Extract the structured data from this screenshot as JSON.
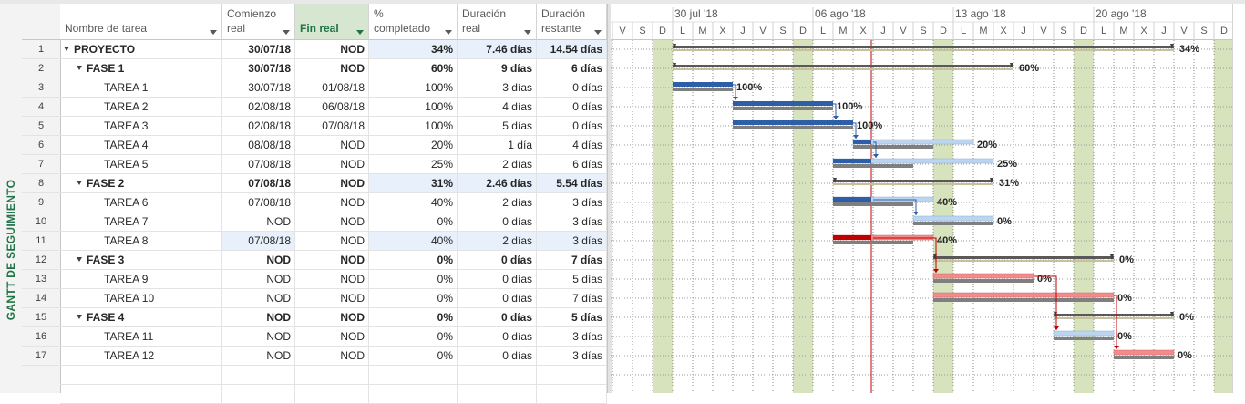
{
  "sidebar": {
    "view_label": "GANTT DE SEGUIMIENTO"
  },
  "columns": [
    {
      "key": "name",
      "line1": "",
      "line2": "Nombre de tarea"
    },
    {
      "key": "start",
      "line1": "Comienzo",
      "line2": "real"
    },
    {
      "key": "finish",
      "line1": "",
      "line2": "Fin real"
    },
    {
      "key": "pct",
      "line1": "%",
      "line2": "completado"
    },
    {
      "key": "dur",
      "line1": "Duración",
      "line2": "real"
    },
    {
      "key": "rem",
      "line1": "Duración",
      "line2": "restante"
    }
  ],
  "tasks": [
    {
      "id": "1",
      "name": "PROYECTO",
      "level": 0,
      "summary": true,
      "start": "30/07/18",
      "finish": "NOD",
      "pct": "34%",
      "dur": "7.46 días",
      "rem": "14.54 días"
    },
    {
      "id": "2",
      "name": "FASE 1",
      "level": 1,
      "summary": true,
      "start": "30/07/18",
      "finish": "NOD",
      "pct": "60%",
      "dur": "9 días",
      "rem": "6 días"
    },
    {
      "id": "3",
      "name": "TAREA 1",
      "level": 2,
      "summary": false,
      "start": "30/07/18",
      "finish": "01/08/18",
      "pct": "100%",
      "dur": "3 días",
      "rem": "0 días"
    },
    {
      "id": "4",
      "name": "TAREA 2",
      "level": 2,
      "summary": false,
      "start": "02/08/18",
      "finish": "06/08/18",
      "pct": "100%",
      "dur": "4 días",
      "rem": "0 días"
    },
    {
      "id": "5",
      "name": "TAREA 3",
      "level": 2,
      "summary": false,
      "start": "02/08/18",
      "finish": "07/08/18",
      "pct": "100%",
      "dur": "5 días",
      "rem": "0 días"
    },
    {
      "id": "6",
      "name": "TAREA 4",
      "level": 2,
      "summary": false,
      "start": "08/08/18",
      "finish": "NOD",
      "pct": "20%",
      "dur": "1 día",
      "rem": "4 días"
    },
    {
      "id": "7",
      "name": "TAREA 5",
      "level": 2,
      "summary": false,
      "start": "07/08/18",
      "finish": "NOD",
      "pct": "25%",
      "dur": "2 días",
      "rem": "6 días"
    },
    {
      "id": "8",
      "name": "FASE 2",
      "level": 1,
      "summary": true,
      "start": "07/08/18",
      "finish": "NOD",
      "pct": "31%",
      "dur": "2.46 días",
      "rem": "5.54 días"
    },
    {
      "id": "9",
      "name": "TAREA 6",
      "level": 2,
      "summary": false,
      "start": "07/08/18",
      "finish": "NOD",
      "pct": "40%",
      "dur": "2 días",
      "rem": "3 días"
    },
    {
      "id": "10",
      "name": "TAREA 7",
      "level": 2,
      "summary": false,
      "start": "NOD",
      "finish": "NOD",
      "pct": "0%",
      "dur": "0 días",
      "rem": "3 días"
    },
    {
      "id": "11",
      "name": "TAREA 8",
      "level": 2,
      "summary": false,
      "start": "07/08/18",
      "finish": "NOD",
      "pct": "40%",
      "dur": "2 días",
      "rem": "3 días"
    },
    {
      "id": "12",
      "name": "FASE 3",
      "level": 1,
      "summary": true,
      "start": "NOD",
      "finish": "NOD",
      "pct": "0%",
      "dur": "0 días",
      "rem": "7 días"
    },
    {
      "id": "13",
      "name": "TAREA 9",
      "level": 2,
      "summary": false,
      "start": "NOD",
      "finish": "NOD",
      "pct": "0%",
      "dur": "0 días",
      "rem": "5 días"
    },
    {
      "id": "14",
      "name": "TAREA 10",
      "level": 2,
      "summary": false,
      "start": "NOD",
      "finish": "NOD",
      "pct": "0%",
      "dur": "0 días",
      "rem": "7 días"
    },
    {
      "id": "15",
      "name": "FASE 4",
      "level": 1,
      "summary": true,
      "start": "NOD",
      "finish": "NOD",
      "pct": "0%",
      "dur": "0 días",
      "rem": "5 días"
    },
    {
      "id": "16",
      "name": "TAREA 11",
      "level": 2,
      "summary": false,
      "start": "NOD",
      "finish": "NOD",
      "pct": "0%",
      "dur": "0 días",
      "rem": "3 días"
    },
    {
      "id": "17",
      "name": "TAREA 12",
      "level": 2,
      "summary": false,
      "start": "NOD",
      "finish": "NOD",
      "pct": "0%",
      "dur": "0 días",
      "rem": "3 días"
    }
  ],
  "timescale": {
    "weeks": [
      "30 jul '18",
      "06 ago '18",
      "13 ago '18",
      "20 ago '18"
    ],
    "days": [
      "V",
      "S",
      "D",
      "L",
      "M",
      "X",
      "J",
      "V",
      "S",
      "D",
      "L",
      "M",
      "X",
      "J",
      "V",
      "S",
      "D",
      "L",
      "M",
      "X",
      "J",
      "V",
      "S",
      "D",
      "L",
      "M",
      "X",
      "J",
      "V",
      "S",
      "D"
    ]
  },
  "gantt": {
    "status_day": 13,
    "bars": [
      {
        "row": 1,
        "kind": "summary",
        "start": 3,
        "end": 28,
        "label": "34%"
      },
      {
        "row": 2,
        "kind": "summary",
        "start": 3,
        "end": 20,
        "label": "60%"
      },
      {
        "row": 3,
        "kind": "task",
        "start": 3,
        "end": 6,
        "complete": 1,
        "label": "100%"
      },
      {
        "row": 4,
        "kind": "task",
        "start": 6,
        "end": 11,
        "complete": 1,
        "label": "100%"
      },
      {
        "row": 5,
        "kind": "task",
        "start": 6,
        "end": 12,
        "complete": 1,
        "label": "100%"
      },
      {
        "row": 6,
        "kind": "task",
        "start": 12,
        "end": 13,
        "remEnd": 18,
        "complete": 0.2,
        "label": "20%"
      },
      {
        "row": 7,
        "kind": "task",
        "start": 11,
        "end": 13,
        "remEnd": 19,
        "complete": 0.25,
        "label": "25%"
      },
      {
        "row": 8,
        "kind": "summary",
        "start": 11,
        "end": 19,
        "label": "31%"
      },
      {
        "row": 9,
        "kind": "task",
        "start": 11,
        "end": 13,
        "remEnd": 16,
        "complete": 0.4,
        "label": "40%"
      },
      {
        "row": 10,
        "kind": "task",
        "start": 15,
        "end": 15,
        "remEnd": 19,
        "complete": 0,
        "label": "0%"
      },
      {
        "row": 11,
        "kind": "critical",
        "start": 11,
        "end": 13,
        "remEnd": 16,
        "complete": 0.4,
        "label": "40%"
      },
      {
        "row": 12,
        "kind": "summary",
        "start": 16,
        "end": 25,
        "label": "0%"
      },
      {
        "row": 13,
        "kind": "critical",
        "start": 16,
        "end": 21,
        "complete": 0,
        "label": "0%"
      },
      {
        "row": 14,
        "kind": "critical",
        "start": 16,
        "end": 25,
        "complete": 0,
        "label": "0%"
      },
      {
        "row": 15,
        "kind": "summary",
        "start": 22,
        "end": 28,
        "label": "0%"
      },
      {
        "row": 16,
        "kind": "task",
        "start": 22,
        "end": 25,
        "complete": 0,
        "label": "0%"
      },
      {
        "row": 17,
        "kind": "critical",
        "start": 25,
        "end": 28,
        "complete": 0,
        "label": "0%"
      }
    ]
  },
  "colors": {
    "accent": "#217346",
    "weekend": "#d6e3bc",
    "task_blue": "#2e5ea8",
    "task_light": "#bcd4ee",
    "critical_red": "#c00000",
    "critical_light": "#f28b8b",
    "baseline": "#7f7f7f",
    "status_line": "#c00000"
  }
}
